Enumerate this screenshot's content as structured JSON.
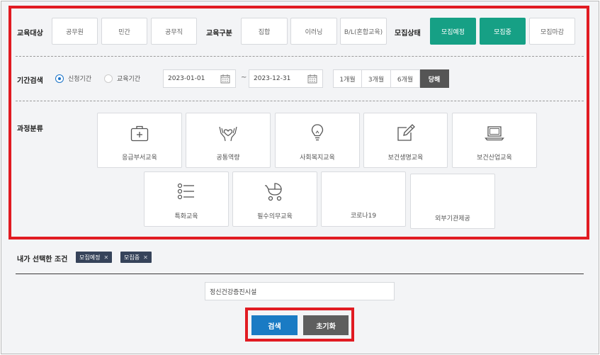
{
  "filters": {
    "edu_target": {
      "label": "교육대상",
      "options": [
        "공무원",
        "민간",
        "공무직"
      ]
    },
    "edu_type": {
      "label": "교육구분",
      "options": [
        "집합",
        "이러닝",
        "B/L(혼합교육)"
      ]
    },
    "recruit_status": {
      "label": "모집상태",
      "options": [
        "모집예정",
        "모집중",
        "모집마감"
      ],
      "active": [
        "모집예정",
        "모집중"
      ]
    },
    "period": {
      "label": "기간검색",
      "radios": [
        "신청기간",
        "교육기간"
      ],
      "selected_radio": "신청기간",
      "start_date": "2023-01-01",
      "end_date": "2023-12-31",
      "separator": "~",
      "presets": [
        "1개월",
        "3개월",
        "6개월",
        "당해"
      ],
      "active_preset": "당해"
    },
    "category": {
      "label": "과정분류",
      "items": [
        {
          "label": "응급부서교육",
          "icon": "first-aid-kit-icon"
        },
        {
          "label": "공통역량",
          "icon": "hands-heart-icon"
        },
        {
          "label": "사회복지교육",
          "icon": "lightbulb-icon"
        },
        {
          "label": "보건생명교육",
          "icon": "edit-pencil-icon"
        },
        {
          "label": "보건산업교육",
          "icon": "laptop-icon"
        },
        {
          "label": "특화교육",
          "icon": "list-icon"
        },
        {
          "label": "필수의무교육",
          "icon": "stroller-icon"
        },
        {
          "label": "코로나19",
          "icon": ""
        },
        {
          "label": "외부기관제공",
          "icon": ""
        }
      ]
    }
  },
  "selected_conditions": {
    "label": "내가 선택한 조건",
    "tags": [
      "모집예정",
      "모집중"
    ]
  },
  "search": {
    "value": "정신건강증진시설"
  },
  "actions": {
    "search_label": "검색",
    "reset_label": "초기화"
  },
  "colors": {
    "active_green": "#16a085",
    "tag_navy": "#36435a",
    "search_blue": "#1a7bc4",
    "reset_gray": "#5e5e5e",
    "highlight_red": "#e11b22"
  }
}
